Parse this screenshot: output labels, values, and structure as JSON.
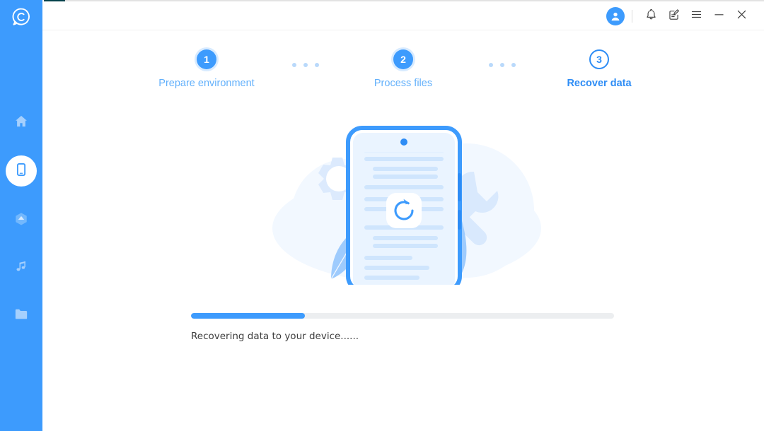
{
  "app": {
    "brand_color": "#3d9bfd",
    "logo_icon": "chat-circle-logo"
  },
  "sidebar": {
    "items": [
      {
        "icon": "home-icon",
        "name": "home",
        "active": false
      },
      {
        "icon": "phone-icon",
        "name": "device",
        "active": true
      },
      {
        "icon": "cloud-icon",
        "name": "cloud",
        "active": false
      },
      {
        "icon": "music-icon",
        "name": "music",
        "active": false
      },
      {
        "icon": "folder-icon",
        "name": "files",
        "active": false
      }
    ]
  },
  "header": {
    "avatar_icon": "user-avatar-icon",
    "actions": [
      {
        "name": "notifications",
        "icon": "bell-icon"
      },
      {
        "name": "feedback",
        "icon": "note-edit-icon"
      },
      {
        "name": "menu",
        "icon": "hamburger-menu-icon"
      },
      {
        "name": "minimize",
        "icon": "minimize-icon"
      },
      {
        "name": "close",
        "icon": "close-icon"
      }
    ]
  },
  "stepper": {
    "steps": [
      {
        "number": "1",
        "label": "Prepare environment",
        "state": "done"
      },
      {
        "number": "2",
        "label": "Process files",
        "state": "done"
      },
      {
        "number": "3",
        "label": "Recover data",
        "state": "current"
      }
    ],
    "separator_dots": 3,
    "done_color": "#3d9bfd",
    "current_color": "#2d8cf5",
    "dot_color": "#b9d9fb"
  },
  "illustration": {
    "name": "phone-data-recovery-illustration",
    "center_icon": "refresh-icon",
    "decor": [
      "gear-icon",
      "wrench-icon",
      "leaf-shape",
      "background-blob"
    ]
  },
  "progress": {
    "percent": 27,
    "percent_label": "27%",
    "fill_color": "#3d9bfd",
    "track_color": "#eceef0",
    "status_text": "Recovering data to your device......"
  }
}
